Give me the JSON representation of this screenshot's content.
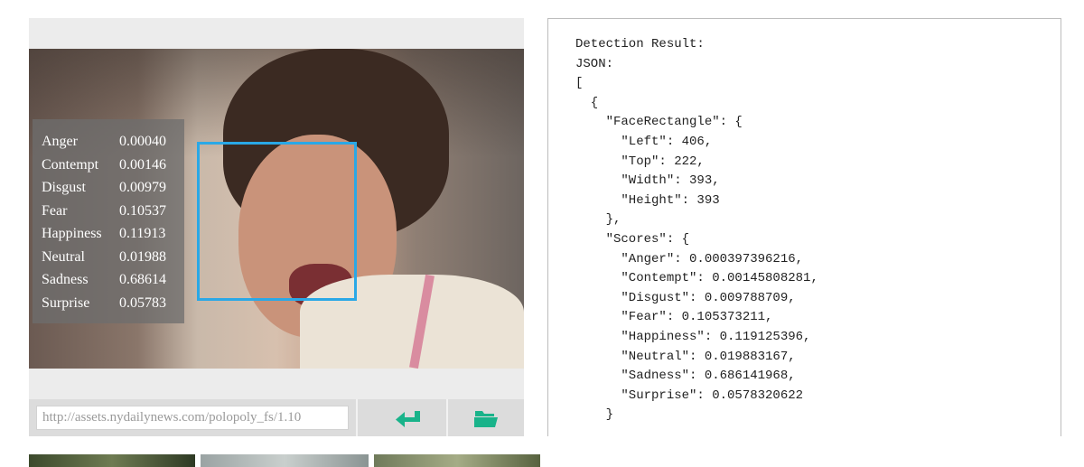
{
  "overlay": {
    "scores": [
      {
        "label": "Anger",
        "value": "0.00040"
      },
      {
        "label": "Contempt",
        "value": "0.00146"
      },
      {
        "label": "Disgust",
        "value": "0.00979"
      },
      {
        "label": "Fear",
        "value": "0.10537"
      },
      {
        "label": "Happiness",
        "value": "0.11913"
      },
      {
        "label": "Neutral",
        "value": "0.01988"
      },
      {
        "label": "Sadness",
        "value": "0.68614"
      },
      {
        "label": "Surprise",
        "value": "0.05783"
      }
    ]
  },
  "url_input": {
    "value": "http://assets.nydailynews.com/polopoly_fs/1.10"
  },
  "buttons": {
    "submit_icon": "enter-arrow-icon",
    "browse_icon": "open-folder-icon"
  },
  "colors": {
    "accent": "#2aa8e6",
    "button_green": "#19b38a"
  },
  "result": {
    "lines": [
      "Detection Result:",
      "JSON:",
      "[",
      "  {",
      "    \"FaceRectangle\": {",
      "      \"Left\": 406,",
      "      \"Top\": 222,",
      "      \"Width\": 393,",
      "      \"Height\": 393",
      "    },",
      "    \"Scores\": {",
      "      \"Anger\": 0.000397396216,",
      "      \"Contempt\": 0.00145808281,",
      "      \"Disgust\": 0.009788709,",
      "      \"Fear\": 0.105373211,",
      "      \"Happiness\": 0.119125396,",
      "      \"Neutral\": 0.019883167,",
      "      \"Sadness\": 0.686141968,",
      "      \"Surprise\": 0.0578320622",
      "    }"
    ]
  }
}
